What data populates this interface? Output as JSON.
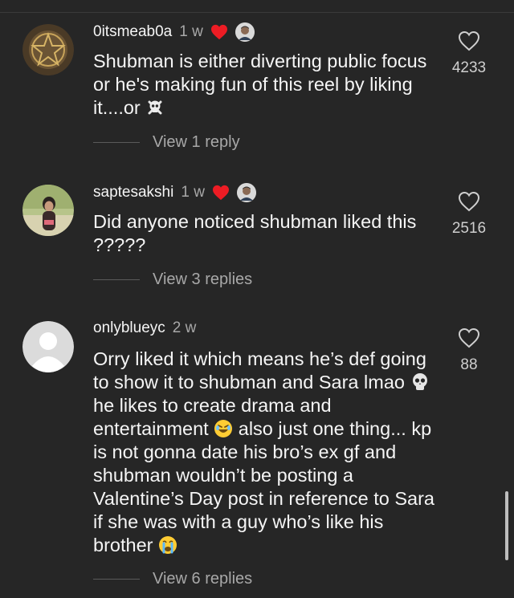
{
  "comments": [
    {
      "username": "0itsmeab0a",
      "time": "1 w",
      "text": "Shubman is either diverting public focus or he's making fun of this reel by liking it....or",
      "like_count": "4233",
      "replies_label": "View 1 reply",
      "text_emoji": "skull-crossbones-icon"
    },
    {
      "username": "saptesakshi",
      "time": "1 w",
      "text": "Did anyone noticed shubman liked this ?????",
      "like_count": "2516",
      "replies_label": "View 3 replies"
    },
    {
      "username": "onlyblueyc",
      "time": "2 w",
      "text_part1": "Orry liked it which means he’s def going to show it to shubman and Sara lmao",
      "text_part2": "he likes to create drama and entertainment",
      "text_part3": "also just one thing... kp is not gonna date his bro’s ex gf and shubman wouldn’t be posting a Valentine’s Day post in reference to Sara if she was with a guy who’s like his brother",
      "like_count": "88",
      "replies_label": "View 6 replies",
      "text_emojis": [
        "skull-icon",
        "rofl-emoji-icon",
        "crying-emoji-icon"
      ]
    }
  ],
  "colors": {
    "background": "#262626",
    "heart_red": "#ed1c24",
    "secondary_text": "#a8a8a8"
  }
}
